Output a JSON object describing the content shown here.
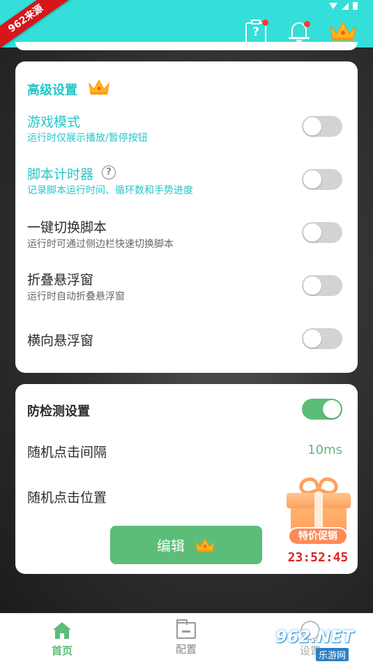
{
  "badge": "962来源",
  "advanced": {
    "title": "高级设置",
    "items": [
      {
        "title": "游戏模式",
        "subtitle": "运行时仅展示播放/暂停按钮"
      },
      {
        "title": "脚本计时器",
        "subtitle": "记录脚本运行时间、循环数和手势进度",
        "help": "?"
      },
      {
        "title": "一键切换脚本",
        "subtitle": "运行时可通过侧边栏快速切换脚本"
      },
      {
        "title": "折叠悬浮窗",
        "subtitle": "运行时自动折叠悬浮窗"
      },
      {
        "title": "横向悬浮窗",
        "subtitle": ""
      }
    ]
  },
  "anti_detect": {
    "title": "防检测设置",
    "interval_label": "随机点击间隔",
    "interval_value": "10ms",
    "position_label": "随机点击位置",
    "edit_label": "编辑"
  },
  "promo": {
    "label": "特价促销",
    "timer": "23:52:45"
  },
  "nav": {
    "home": "首页",
    "config": "配置",
    "third": "设置"
  },
  "watermark": {
    "main": "962.NET",
    "sub": "乐游网"
  },
  "colors": {
    "header": "#35dfd9",
    "accent_green": "#5cbd79",
    "teal_text": "#25c6c9",
    "timer_red": "#e02222"
  }
}
